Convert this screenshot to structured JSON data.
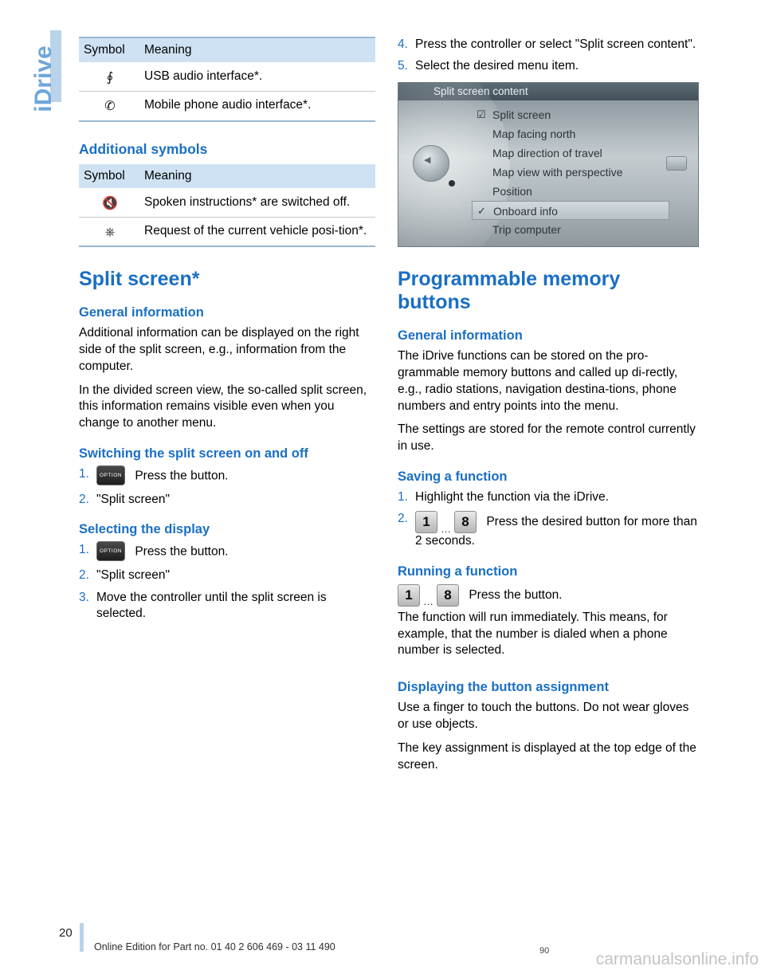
{
  "side_tab": {
    "label": "iDrive"
  },
  "left_column": {
    "table1": {
      "headers": [
        "Symbol",
        "Meaning"
      ],
      "rows": [
        {
          "symbol": "usb-icon",
          "meaning": "USB audio interface*."
        },
        {
          "symbol": "mobile-phone-audio-icon",
          "meaning": "Mobile phone audio interface*."
        }
      ]
    },
    "additional_symbols_heading": "Additional symbols",
    "table2": {
      "headers": [
        "Symbol",
        "Meaning"
      ],
      "rows": [
        {
          "symbol": "speaker-muted-icon",
          "meaning": "Spoken instructions* are switched off."
        },
        {
          "symbol": "vehicle-position-icon",
          "meaning": "Request of the current vehicle posi-tion*."
        }
      ]
    },
    "split_screen_title": "Split screen*",
    "general_information_heading": "General information",
    "general_info_p1": "Additional information can be displayed on the right side of the split screen, e.g., information from the computer.",
    "general_info_p2": "In the divided screen view, the so-called split screen, this information remains visible even when you change to another menu.",
    "switching_heading": "Switching the split screen on and off",
    "switching_steps": [
      {
        "num": "1.",
        "icon": "OPTION",
        "text": "Press the button."
      },
      {
        "num": "2.",
        "text": "\"Split screen\""
      }
    ],
    "selecting_heading": "Selecting the display",
    "selecting_steps": [
      {
        "num": "1.",
        "icon": "OPTION",
        "text": "Press the button."
      },
      {
        "num": "2.",
        "text": "\"Split screen\""
      },
      {
        "num": "3.",
        "text": "Move the controller until the split screen is selected."
      }
    ]
  },
  "right_column": {
    "top_steps": [
      {
        "num": "4.",
        "text": "Press the controller or select \"Split screen content\"."
      },
      {
        "num": "5.",
        "text": "Select the desired menu item."
      }
    ],
    "idrive_screen": {
      "title": "Split screen content",
      "items": [
        {
          "label": "Split screen",
          "mark": "checkbox",
          "selected": false
        },
        {
          "label": "Map facing north",
          "mark": "",
          "selected": false
        },
        {
          "label": "Map direction of travel",
          "mark": "",
          "selected": false
        },
        {
          "label": "Map view with perspective",
          "mark": "",
          "selected": false
        },
        {
          "label": "Position",
          "mark": "",
          "selected": false
        },
        {
          "label": "Onboard info",
          "mark": "check",
          "selected": true
        },
        {
          "label": "Trip computer",
          "mark": "",
          "selected": false
        }
      ]
    },
    "memory_buttons_title": "Programmable memory buttons",
    "general_information_heading": "General information",
    "general_info_p1": "The iDrive functions can be stored on the pro-grammable memory buttons and called up di-rectly, e.g., radio stations, navigation destina-tions, phone numbers and entry points into the menu.",
    "general_info_p2": "The settings are stored for the remote control currently in use.",
    "saving_heading": "Saving a function",
    "saving_steps": [
      {
        "num": "1.",
        "text": "Highlight the function via the iDrive."
      },
      {
        "num": "2.",
        "btn_first": "1",
        "dots": "…",
        "btn_last": "8",
        "text": "Press the desired button for more than 2 seconds."
      }
    ],
    "running_heading": "Running a function",
    "running_btn_first": "1",
    "running_dots": "…",
    "running_btn_last": "8",
    "running_press": "Press the button.",
    "running_p1": "The function will run immediately. This means, for example, that the number is dialed when a phone number is selected.",
    "displaying_heading": "Displaying the button assignment",
    "displaying_p1": "Use a finger to touch the buttons. Do not wear gloves or use objects.",
    "displaying_p2": "The key assignment is displayed at the top edge of the screen."
  },
  "footer": {
    "page_number": "20",
    "text": "Online Edition for Part no. 01 40 2 606 469 - 03 11 490",
    "small_page": "90",
    "watermark": "carmanualsonline.info"
  },
  "colors": {
    "accent_blue": "#1a6fc4",
    "table_header_bg": "#cfe2f3",
    "tab_blue": "#6ea6d9"
  }
}
